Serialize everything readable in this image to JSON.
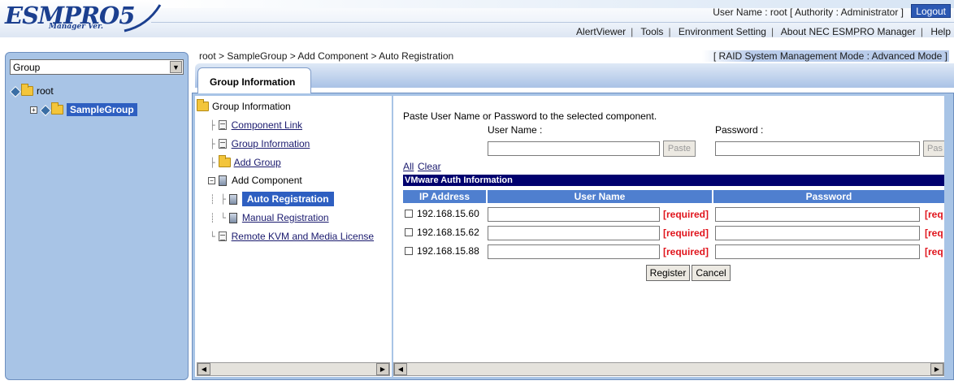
{
  "header": {
    "logo_text": "ESMPRO5",
    "logo_subtitle": "Manager Ver.",
    "user_info": "User Name :  root  [ Authority : Administrator ]",
    "logout_label": "Logout",
    "nav": [
      "AlertViewer",
      "Tools",
      "Environment Setting",
      "About NEC ESMPRO Manager",
      "Help"
    ]
  },
  "left": {
    "group_select": "Group",
    "tree": [
      {
        "label": "root"
      },
      {
        "label": "SampleGroup",
        "selected": true
      }
    ]
  },
  "main": {
    "breadcrumb": "root > SampleGroup > Add Component > Auto Registration",
    "mode": "[ RAID System Management Mode : Advanced Mode ]",
    "tab": "Group Information"
  },
  "subtree": {
    "root": "Group Information",
    "items": {
      "component_link": "Component Link",
      "group_information": "Group Information",
      "add_group": "Add Group",
      "add_component": "Add Component",
      "auto_registration": "Auto Registration",
      "manual_registration": "Manual Registration",
      "remote_kvm": "Remote KVM and Media License"
    }
  },
  "content": {
    "instruction": "Paste User Name or Password to the selected component.",
    "username_label": "User Name :",
    "password_label": "Password :",
    "paste_label": "Paste",
    "paste_label_cut": "Pas",
    "all_label": "All",
    "clear_label": "Clear",
    "section_title": "VMware Auth Information",
    "columns": {
      "ip": "IP Address",
      "user": "User Name",
      "password": "Password"
    },
    "required_label": "[required]",
    "required_label_cut": "[req",
    "rows": [
      {
        "ip": "192.168.15.60"
      },
      {
        "ip": "192.168.15.62"
      },
      {
        "ip": "192.168.15.88"
      }
    ],
    "register_label": "Register",
    "cancel_label": "Cancel"
  }
}
